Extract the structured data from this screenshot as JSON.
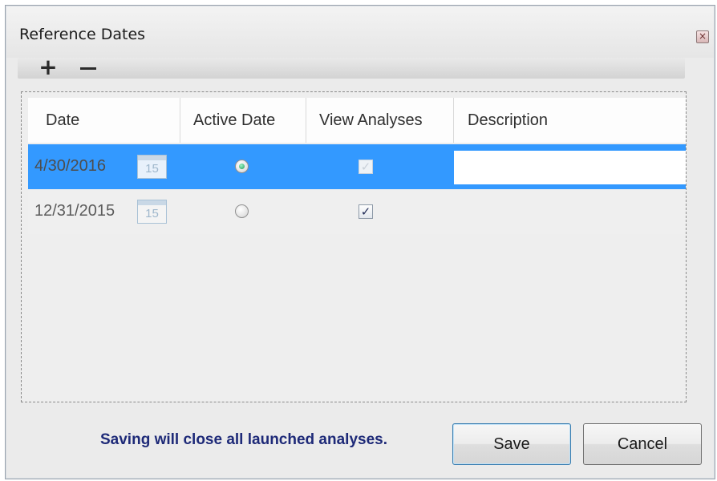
{
  "window": {
    "title": "Reference Dates",
    "close_glyph": "×"
  },
  "toolbar": {
    "add_glyph": "+",
    "add_icon": "plus-icon",
    "remove_icon": "minus-icon"
  },
  "grid": {
    "columns": [
      "Date",
      "Active Date",
      "View Analyses",
      "Description"
    ],
    "rows": [
      {
        "date": "4/30/2016",
        "calendar_day": "15",
        "active": true,
        "view_analyses": true,
        "view_enabled": false,
        "description": "",
        "selected": true
      },
      {
        "date": "12/31/2015",
        "calendar_day": "15",
        "active": false,
        "view_analyses": true,
        "view_enabled": true,
        "description": "",
        "selected": false
      }
    ]
  },
  "footer": {
    "message": "Saving will close all launched analyses.",
    "save_label": "Save",
    "cancel_label": "Cancel"
  },
  "colors": {
    "selection": "#3399ff",
    "message": "#1e2a78",
    "radio_on": "#1a9a56"
  },
  "check_glyph": "✓"
}
